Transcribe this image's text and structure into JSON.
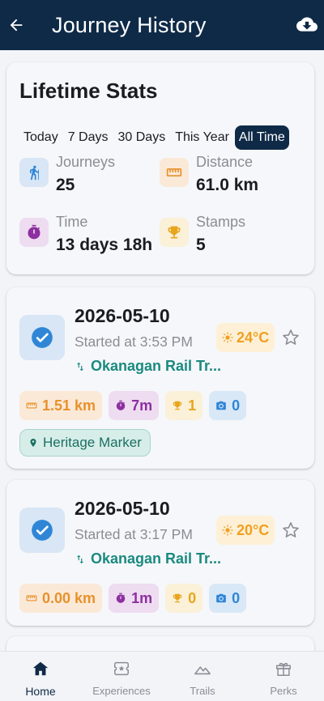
{
  "appbar": {
    "title": "Journey History"
  },
  "stats": {
    "title": "Lifetime Stats",
    "ranges": [
      "Today",
      "7 Days",
      "30 Days",
      "This Year",
      "All Time"
    ],
    "active_range": "All Time",
    "journeys": {
      "label": "Journeys",
      "value": "25"
    },
    "distance": {
      "label": "Distance",
      "value": "61.0 km"
    },
    "time": {
      "label": "Time",
      "value": "13 days 18h"
    },
    "stamps": {
      "label": "Stamps",
      "value": "5"
    }
  },
  "journeys": [
    {
      "date": "2026-05-10",
      "started": "Started at 3:53 PM",
      "trail": "Okanagan Rail Tr...",
      "temp": "24°C",
      "distance": "1.51 km",
      "duration": "7m",
      "stamps": "1",
      "photos": "0",
      "marker": "Heritage Marker"
    },
    {
      "date": "2026-05-10",
      "started": "Started at 3:17 PM",
      "trail": "Okanagan Rail Tr...",
      "temp": "20°C",
      "distance": "0.00 km",
      "duration": "1m",
      "stamps": "0",
      "photos": "0"
    }
  ],
  "nav": [
    {
      "label": "Home",
      "icon": "home-icon",
      "active": true
    },
    {
      "label": "Experiences",
      "icon": "ticket-icon",
      "active": false
    },
    {
      "label": "Trails",
      "icon": "mountain-icon",
      "active": false
    },
    {
      "label": "Perks",
      "icon": "gift-icon",
      "active": false
    }
  ],
  "colors": {
    "primary": "#0f2a47",
    "trail_green": "#1a8a80",
    "check_blue": "#2f86d6",
    "distance_orange": "#e8912a",
    "time_purple": "#8d2fa0",
    "stamp_gold": "#e7a51c",
    "weather_amber": "#f0a020"
  }
}
